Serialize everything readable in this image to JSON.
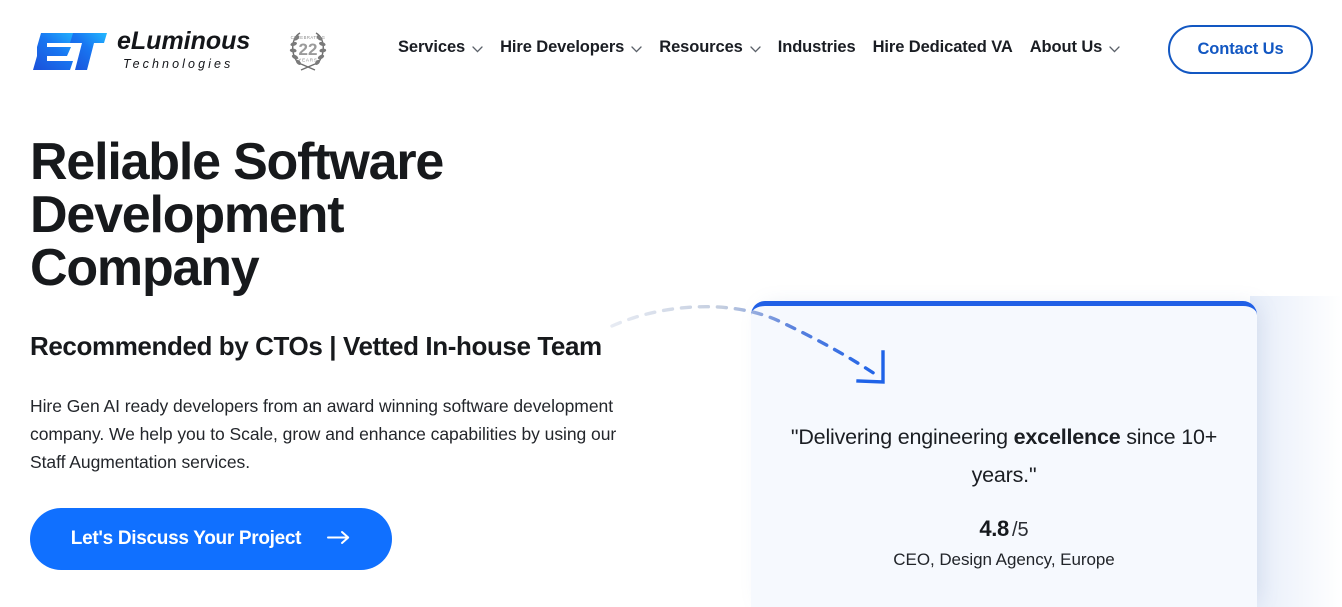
{
  "header": {
    "brand": {
      "mark_text": "ET",
      "name": "eLuminous",
      "tagline": "Technologies",
      "badge": {
        "top_text": "CELEBRATING",
        "number": "22",
        "bottom_text": "YEARS"
      }
    },
    "nav_items": [
      {
        "label": "Services",
        "has_dropdown": true
      },
      {
        "label": "Hire Developers",
        "has_dropdown": true
      },
      {
        "label": "Resources",
        "has_dropdown": true
      },
      {
        "label": "Industries",
        "has_dropdown": false
      },
      {
        "label": "Hire Dedicated VA",
        "has_dropdown": false
      },
      {
        "label": "About Us",
        "has_dropdown": true
      }
    ],
    "contact_button": "Contact Us"
  },
  "hero": {
    "headline": "Reliable Software Development Company",
    "subheadline": "Recommended by CTOs | Vetted In-house Team",
    "paragraph": "Hire Gen AI ready developers from an award winning software development company. We help you to Scale, grow and enhance capabilities by using our Staff Augmentation services.",
    "cta_label": "Let's Discuss Your Project",
    "cta_icon": "arrow-right-icon"
  },
  "testimonial": {
    "quote_part1": "\"Delivering engineering ",
    "quote_highlight": "excellence",
    "quote_part2": " since 10+ years.\"",
    "rating_score": "4.8",
    "rating_out_of": "/5",
    "attribution": "CEO, Design Agency, Europe"
  },
  "colors": {
    "accent_blue": "#1070ff",
    "border_blue": "#2160e6",
    "outline_blue": "#1257c2",
    "card_bg": "#f6f9fe",
    "text_dark": "#17191c"
  }
}
